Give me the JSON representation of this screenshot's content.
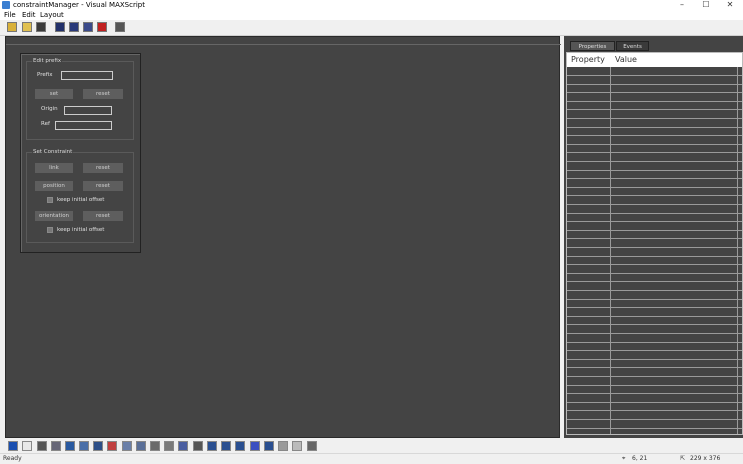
{
  "window": {
    "title": "constraintManager - Visual MAXScript",
    "minimize": "–",
    "maximize": "☐",
    "close": "✕"
  },
  "menu": [
    "File",
    "Edit",
    "Layout"
  ],
  "toolbar_icons": [
    "new-icon",
    "open-icon",
    "save-icon",
    "script-icon",
    "run-icon",
    "blank-icon",
    "close-file-icon",
    "grid-icon"
  ],
  "rollout": {
    "edit_prefix": {
      "group_label": "Edit prefix",
      "prefix_label": "Prefix",
      "set_label": "set",
      "reset_label": "reset",
      "origin_label": "Origin",
      "ref_label": "Ref"
    },
    "set_constraint": {
      "group_label": "Set Constraint",
      "link_label": "link",
      "link_reset_label": "reset",
      "position_label": "position",
      "position_reset_label": "reset",
      "keep_offset_1": "keep initial offset",
      "orientation_label": "orientation",
      "orientation_reset_label": "reset",
      "keep_offset_2": "keep initial offset"
    }
  },
  "right_panel": {
    "tabs": [
      "Properties",
      "Events"
    ],
    "columns": [
      "Property",
      "Value"
    ]
  },
  "bottom_tools": [
    "pointer-tool-icon",
    "bitmap-tool-icon",
    "button-tool-icon",
    "mapbutton-tool-icon",
    "materialbutton-tool-icon",
    "pickbutton-tool-icon",
    "checkbutton-tool-icon",
    "colorpicker-tool-icon",
    "combobox-tool-icon",
    "dropdown-tool-icon",
    "listbox-tool-icon",
    "edittext-tool-icon",
    "label-tool-icon",
    "groupbox-tool-icon",
    "checkbox-tool-icon",
    "radiobuttons-tool-icon",
    "spinner-tool-icon",
    "progressbar-tool-icon",
    "slider-tool-icon",
    "timer-tool-icon",
    "activex-tool-icon",
    "imgtag-tool-icon"
  ],
  "status": {
    "text": "Ready",
    "coords": "6, 21",
    "size": "229 x 376"
  }
}
